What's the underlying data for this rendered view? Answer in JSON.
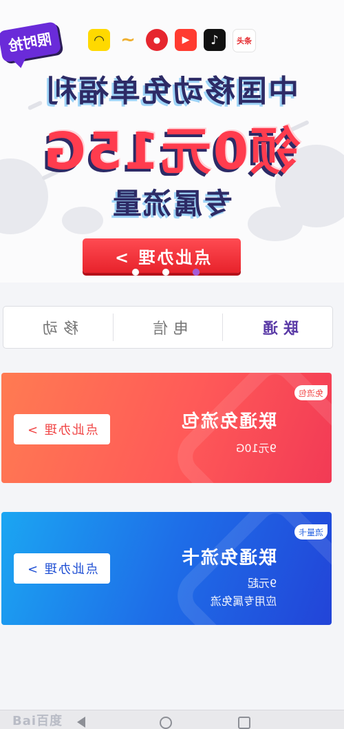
{
  "hero": {
    "limited_badge": "限时抢",
    "app_icons": [
      {
        "name": "yellow-smile-app-icon",
        "glyph": "◠"
      },
      {
        "name": "wave-app-icon",
        "glyph": "~"
      },
      {
        "name": "red-circle-app-icon",
        "glyph": "●"
      },
      {
        "name": "red-play-app-icon",
        "glyph": "▶"
      },
      {
        "name": "tiktok-app-icon",
        "glyph": "♪"
      },
      {
        "name": "toutiao-app-icon",
        "glyph": "头条"
      }
    ],
    "headline_line1": "中国移动免单福利",
    "headline_line2": "领0元15G",
    "headline_line3": "专属流量",
    "cta_label": "点此办理 >",
    "carousel_dots": 3,
    "active_dot": 2
  },
  "tabs": [
    {
      "label": "移动",
      "active": false
    },
    {
      "label": "电信",
      "active": false
    },
    {
      "label": "联通",
      "active": true
    }
  ],
  "cards": {
    "pack": {
      "badge": "免流包",
      "title": "联通免流包",
      "line1": "9元10G",
      "button": "点此办理 >"
    },
    "sim": {
      "badge": "流量卡",
      "title": "联通免流卡",
      "line1": "9元起",
      "line2": "应用专属免流",
      "button": "点此办理 >"
    }
  },
  "bottom": {
    "watermark": "Bai百度"
  },
  "colors": {
    "hero_red": "#ff3c4e",
    "navy": "#2d2b66",
    "purple": "#6a2bd9",
    "card_orange": "#ff6a55",
    "card_blue": "#1e6ee8"
  }
}
